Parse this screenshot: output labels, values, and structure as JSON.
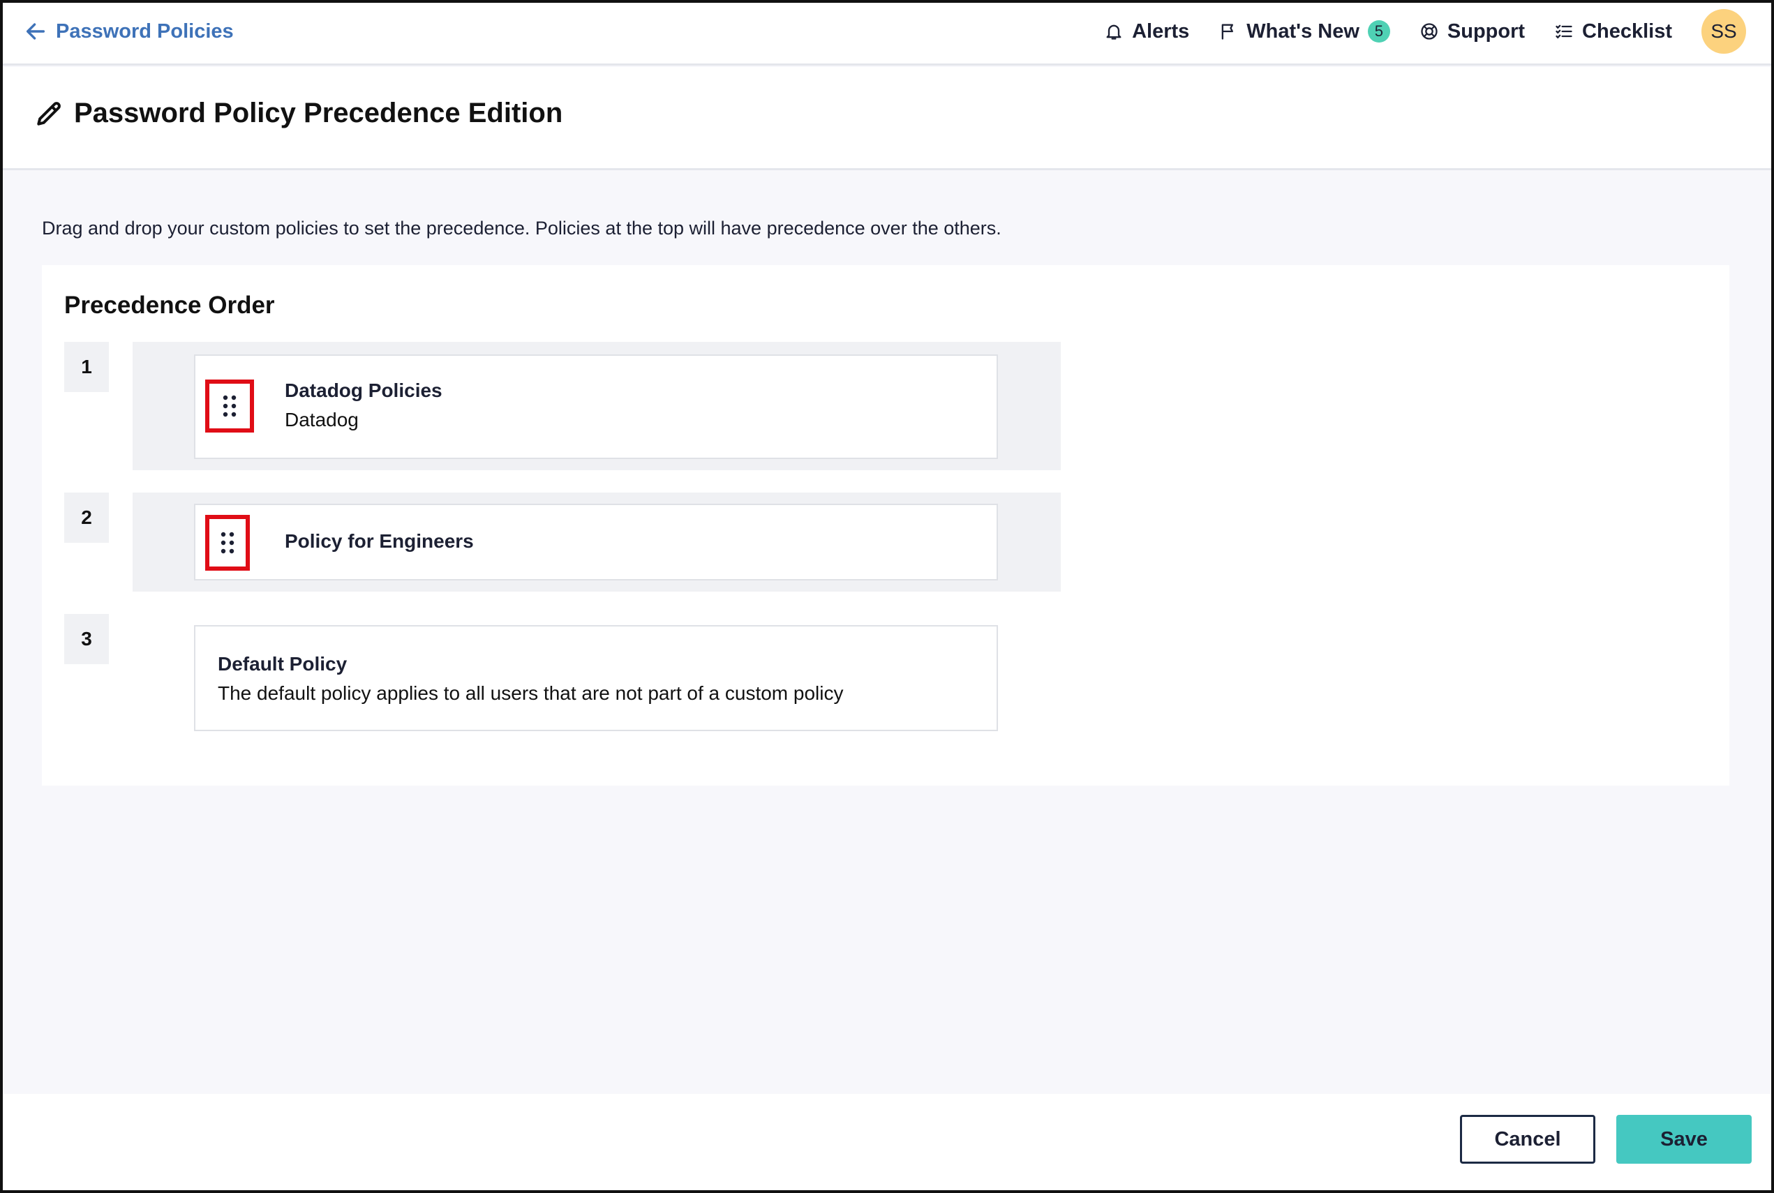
{
  "header": {
    "back_label": "Password Policies",
    "back_icon": "arrow-left-icon",
    "actions": {
      "alerts": "Alerts",
      "whats_new": "What's New",
      "whats_new_count": "5",
      "support": "Support",
      "checklist": "Checklist"
    },
    "avatar_initials": "SS"
  },
  "page": {
    "title": "Password Policy Precedence Edition",
    "title_icon": "pencil-icon",
    "instructions": "Drag and drop your custom policies to set the precedence. Policies at the top will have precedence over the others."
  },
  "precedence": {
    "title": "Precedence Order",
    "items": [
      {
        "rank": "1",
        "name": "Datadog Policies",
        "subtitle": "Datadog",
        "draggable": true
      },
      {
        "rank": "2",
        "name": "Policy for Engineers",
        "subtitle": "",
        "draggable": true
      },
      {
        "rank": "3",
        "name": "Default Policy",
        "subtitle": "The default policy applies to all users that are not part of a custom policy",
        "draggable": false
      }
    ]
  },
  "footer": {
    "cancel_label": "Cancel",
    "save_label": "Save"
  },
  "colors": {
    "link": "#3e72b8",
    "badge": "#4fd1b4",
    "avatar": "#fcd27e",
    "save": "#45c8c1",
    "highlight": "#e00d16"
  }
}
